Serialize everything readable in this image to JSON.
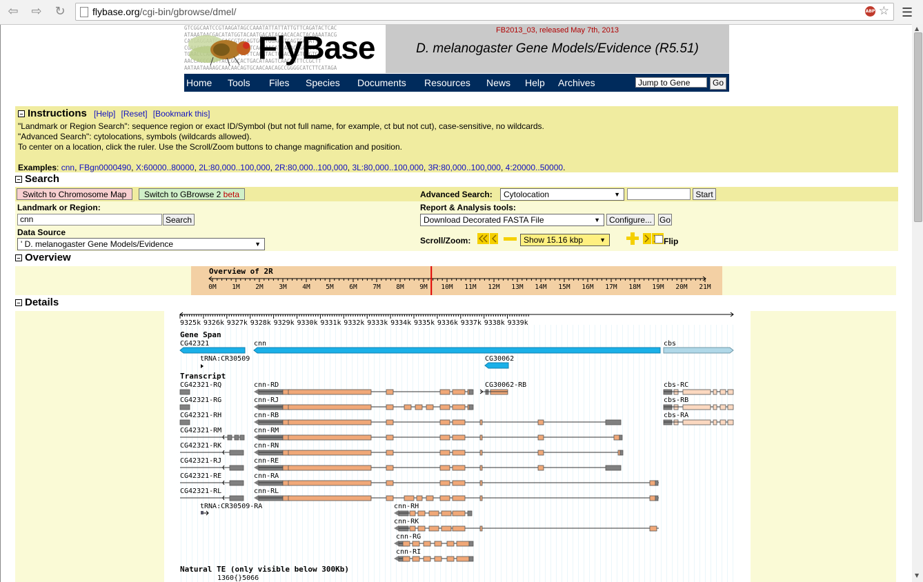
{
  "browser": {
    "url_domain": "flybase.org",
    "url_path": "/cgi-bin/gbrowse/dmel/",
    "abp_label": "ABP"
  },
  "banner": {
    "logo": "FlyBase",
    "release": "FB2013_03, released May 7th, 2013",
    "title": "D. melanogaster Gene Models/Evidence (R5.51)",
    "seq_lines": [
      "GTCGGCAATCCGTAAGATAGCCAAATATTATTATTGTTCAGATACTCAC",
      "ATAAATAACGACATATGGTACAATGACATACAACACACTACAAAATACG",
      "CATGAGGAATGGCAGCGTGGAGTGCTTGGAAATCAGTGAAATT",
      "CGAAAATCAAACGATTTCTGGTCAAGAAGATCAAACAGCGGGC",
      "TGAACCCAAAAGCGGCATTTTTCAGATACTCGACAAGTGAGTG",
      "AACCACCCAGTTACCGGCACTGACATAAGTCAACGGTTCCGCTT",
      "AATAATAAAAGCAACAACAGTGCAACAACAGCCGGGGCATCTTCATAGA"
    ]
  },
  "topnav": {
    "items": [
      "Home",
      "Tools",
      "Files",
      "Species",
      "Documents",
      "Resources",
      "News",
      "Help",
      "Archives"
    ],
    "jump_value": "Jump to Gene",
    "go_label": "Go"
  },
  "instructions": {
    "heading": "Instructions",
    "help": "[Help]",
    "reset": "[Reset]",
    "bookmark": "[Bookmark this]",
    "line1": "\"Landmark or Region Search\": sequence region or exact ID/Symbol (but not full name, for example, ct but not cut), case-sensitive, no wildcards.",
    "line2": "\"Advanced Search\": cytolocations, symbols (wildcards allowed).",
    "line3": "To center on a location, click the ruler. Use the Scroll/Zoom buttons to change magnification and position.",
    "examples_label": "Examples",
    "examples": [
      "cnn",
      "FBgn0000490",
      "X:60000..80000",
      "2L:80,000..100,000",
      "2R:80,000..100,000",
      "3L:80,000..100,000",
      "3R:80,000..100,000",
      "4:20000..50000"
    ]
  },
  "search": {
    "heading": "Search",
    "chromosome_map_btn": "Switch to Chromosome Map",
    "gbrowse2_btn": "Switch to GBrowse 2",
    "gbrowse2_beta": "beta",
    "landmark_label": "Landmark or Region",
    "landmark_value": "cnn",
    "search_btn": "Search",
    "data_source_label": "Data Source",
    "data_source_value": "' D. melanogaster Gene Models/Evidence",
    "advanced_label": "Advanced Search:",
    "advanced_select": "Cytolocation",
    "advanced_value": "",
    "start_btn": "Start",
    "report_label": "Report & Analysis tools",
    "report_select": "Download Decorated FASTA File",
    "configure_btn": "Configure...",
    "go_btn": "Go",
    "scroll_label": "Scroll/Zoom:",
    "zoom_select": "Show 15.16 kbp",
    "flip_label": "Flip"
  },
  "overview": {
    "heading": "Overview",
    "title": "Overview of 2R",
    "ticks": [
      "0M",
      "1M",
      "2M",
      "3M",
      "4M",
      "5M",
      "6M",
      "7M",
      "8M",
      "9M",
      "10M",
      "11M",
      "12M",
      "13M",
      "14M",
      "15M",
      "16M",
      "17M",
      "18M",
      "19M",
      "20M",
      "21M"
    ],
    "marker_mb": 9.33
  },
  "details": {
    "heading": "Details",
    "ruler": [
      "9325k",
      "9326k",
      "9327k",
      "9328k",
      "9329k",
      "9330k",
      "9331k",
      "9332k",
      "9333k",
      "9334k",
      "9335k",
      "9336k",
      "9337k",
      "9338k",
      "9339k"
    ],
    "gene_span_label": "Gene Span",
    "genes": [
      "CG42321",
      "cnn",
      "cbs",
      "tRNA:CR30509",
      "CG30062"
    ],
    "transcript_label": "Transcript",
    "transcripts_left": [
      "CG42321-RQ",
      "CG42321-RG",
      "CG42321-RH",
      "CG42321-RM",
      "CG42321-RK",
      "CG42321-RJ",
      "CG42321-RE",
      "CG42321-RL"
    ],
    "transcripts_cnn": [
      "cnn-RD",
      "cnn-RJ",
      "cnn-RB",
      "cnn-RM",
      "cnn-RN",
      "cnn-RE",
      "cnn-RA",
      "cnn-RL"
    ],
    "transcripts_cnn_short": [
      "cnn-RH",
      "cnn-RK",
      "cnn-RG",
      "cnn-RI"
    ],
    "transcripts_cbs": [
      "cbs-RC",
      "cbs-RB",
      "cbs-RA"
    ],
    "other_transcripts": [
      "CG30062-RB",
      "tRNA:CR30509-RA"
    ],
    "natural_te_label": "Natural TE (only visible below 300Kb)",
    "te_item": "1360{}5066"
  },
  "colors": {
    "nav_bg": "#002b5c",
    "panel_yellow": "#f0eca0",
    "panel_light": "#fafad6",
    "exon_orange": "#f0a878",
    "utr_gray": "#808080",
    "gene_blue": "#1ab0e8"
  }
}
